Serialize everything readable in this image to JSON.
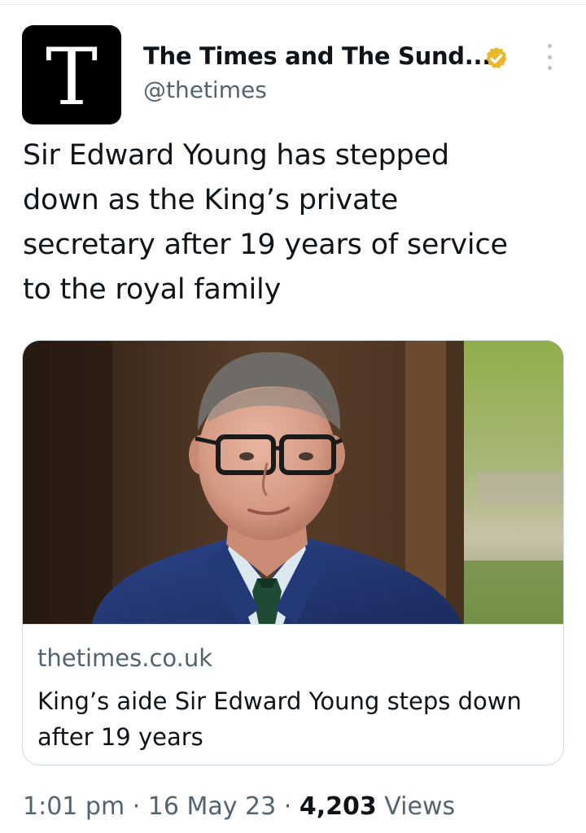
{
  "account": {
    "avatar_letter": "T",
    "display_name": "The Times and The Sund...",
    "handle": "@thetimes",
    "verified_badge_icon": "gold-verified-badge-icon",
    "badge_color": "#e8b82e"
  },
  "tweet": {
    "text_lines": [
      "Sir Edward Young has stepped",
      "down as the King’s private",
      "secretary after 19 years of service",
      "to the royal family"
    ]
  },
  "card": {
    "image_description_icon": "photo-of-man-in-glasses-and-suit",
    "domain": "thetimes.co.uk",
    "title_lines": [
      "King’s aide Sir Edward Young steps down",
      "after 19 years"
    ]
  },
  "meta": {
    "time": "1:01 pm",
    "separator": " · ",
    "date": "16 May 23",
    "views_count": "4,203",
    "views_label": " Views"
  },
  "colors": {
    "text_primary": "#0f1419",
    "text_secondary": "#536471",
    "border": "#cfd9de"
  }
}
